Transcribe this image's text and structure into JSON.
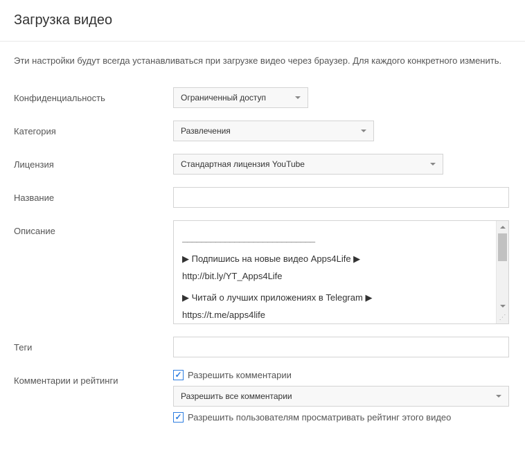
{
  "header": {
    "title": "Загрузка видео"
  },
  "intro": "Эти настройки будут всегда устанавливаться при загрузке видео через браузер. Для каждого конкретного изменить.",
  "fields": {
    "privacy": {
      "label": "Конфиденциальность",
      "value": "Ограниченный доступ"
    },
    "category": {
      "label": "Категория",
      "value": "Развлечения"
    },
    "license": {
      "label": "Лицензия",
      "value": "Стандартная лицензия YouTube"
    },
    "title": {
      "label": "Название",
      "value": ""
    },
    "description": {
      "label": "Описание",
      "divider": "____________________________",
      "line1_prefix": "▶",
      "line1_text": "Подпишись на новые видео Apps4Life",
      "line1_suffix": "▶",
      "line1_url": "http://bit.ly/YT_Apps4Life",
      "line2_prefix": "▶",
      "line2_text": "Читай о лучших приложениях в Telegram ",
      "line2_suffix": "▶",
      "line2_url": "https://t.me/apps4life"
    },
    "tags": {
      "label": "Теги",
      "value": ""
    },
    "comments": {
      "label": "Комментарии и рейтинги",
      "allow_comments": "Разрешить комментарии",
      "comments_mode": "Разрешить все комментарии",
      "allow_ratings": "Разрешить пользователям просматривать рейтинг этого видео"
    }
  }
}
